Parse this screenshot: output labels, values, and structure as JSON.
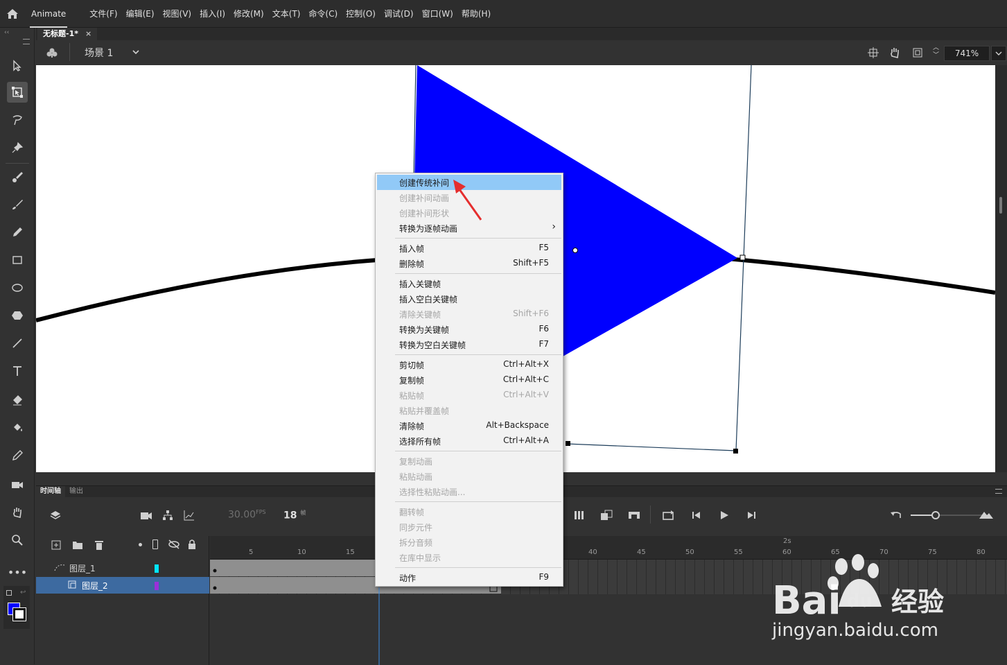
{
  "app": {
    "name": "Animate"
  },
  "menubar": {
    "items": [
      "文件(F)",
      "编辑(E)",
      "视图(V)",
      "插入(I)",
      "修改(M)",
      "文本(T)",
      "命令(C)",
      "控制(O)",
      "调试(D)",
      "窗口(W)",
      "帮助(H)"
    ]
  },
  "document": {
    "tab_title": "无标题-1*",
    "close_glyph": "×"
  },
  "scene": {
    "label": "场景 1",
    "zoom": "741%"
  },
  "colors": {
    "fill": "#0000ff",
    "stroke": "#000000",
    "highlight": "#91c9f7",
    "selected_layer": "#3d6aa0"
  },
  "context_menu": {
    "groups": [
      [
        {
          "label": "创建传统补间",
          "shortcut": "",
          "enabled": true,
          "highlighted": true
        },
        {
          "label": "创建补间动画",
          "shortcut": "",
          "enabled": false
        },
        {
          "label": "创建补间形状",
          "shortcut": "",
          "enabled": false
        },
        {
          "label": "转换为逐帧动画",
          "shortcut": "›",
          "enabled": true
        }
      ],
      [
        {
          "label": "插入帧",
          "shortcut": "F5",
          "enabled": true
        },
        {
          "label": "删除帧",
          "shortcut": "Shift+F5",
          "enabled": true
        }
      ],
      [
        {
          "label": "插入关键帧",
          "shortcut": "",
          "enabled": true
        },
        {
          "label": "插入空白关键帧",
          "shortcut": "",
          "enabled": true
        },
        {
          "label": "清除关键帧",
          "shortcut": "Shift+F6",
          "enabled": false
        },
        {
          "label": "转换为关键帧",
          "shortcut": "F6",
          "enabled": true
        },
        {
          "label": "转换为空白关键帧",
          "shortcut": "F7",
          "enabled": true
        }
      ],
      [
        {
          "label": "剪切帧",
          "shortcut": "Ctrl+Alt+X",
          "enabled": true
        },
        {
          "label": "复制帧",
          "shortcut": "Ctrl+Alt+C",
          "enabled": true
        },
        {
          "label": "粘贴帧",
          "shortcut": "Ctrl+Alt+V",
          "enabled": false
        },
        {
          "label": "粘贴并覆盖帧",
          "shortcut": "",
          "enabled": false
        },
        {
          "label": "清除帧",
          "shortcut": "Alt+Backspace",
          "enabled": true
        },
        {
          "label": "选择所有帧",
          "shortcut": "Ctrl+Alt+A",
          "enabled": true
        }
      ],
      [
        {
          "label": "复制动画",
          "shortcut": "",
          "enabled": false
        },
        {
          "label": "粘贴动画",
          "shortcut": "",
          "enabled": false
        },
        {
          "label": "选择性粘贴动画...",
          "shortcut": "",
          "enabled": false
        }
      ],
      [
        {
          "label": "翻转帧",
          "shortcut": "",
          "enabled": false
        },
        {
          "label": "同步元件",
          "shortcut": "",
          "enabled": false
        },
        {
          "label": "拆分音频",
          "shortcut": "",
          "enabled": false
        },
        {
          "label": "在库中显示",
          "shortcut": "",
          "enabled": false
        }
      ],
      [
        {
          "label": "动作",
          "shortcut": "F9",
          "enabled": true
        }
      ]
    ]
  },
  "timeline": {
    "tabs": [
      "时间轴",
      "输出"
    ],
    "fps": "30.00",
    "fps_unit": "FPS",
    "current_frame": "18",
    "frame_unit": "帧",
    "ruler_labels": [
      "5",
      "10",
      "15",
      "40",
      "45",
      "50",
      "55",
      "60",
      "65",
      "70",
      "75",
      "80"
    ],
    "seconds_marker": "2s",
    "layers": [
      {
        "name": "图层_1",
        "color": "#00e5ff",
        "selected": false
      },
      {
        "name": "图层_2",
        "color": "#9b30d9",
        "selected": true
      }
    ]
  },
  "watermark": {
    "brand": "Bai",
    "brand2": "经验",
    "url": "jingyan.baidu.com"
  }
}
